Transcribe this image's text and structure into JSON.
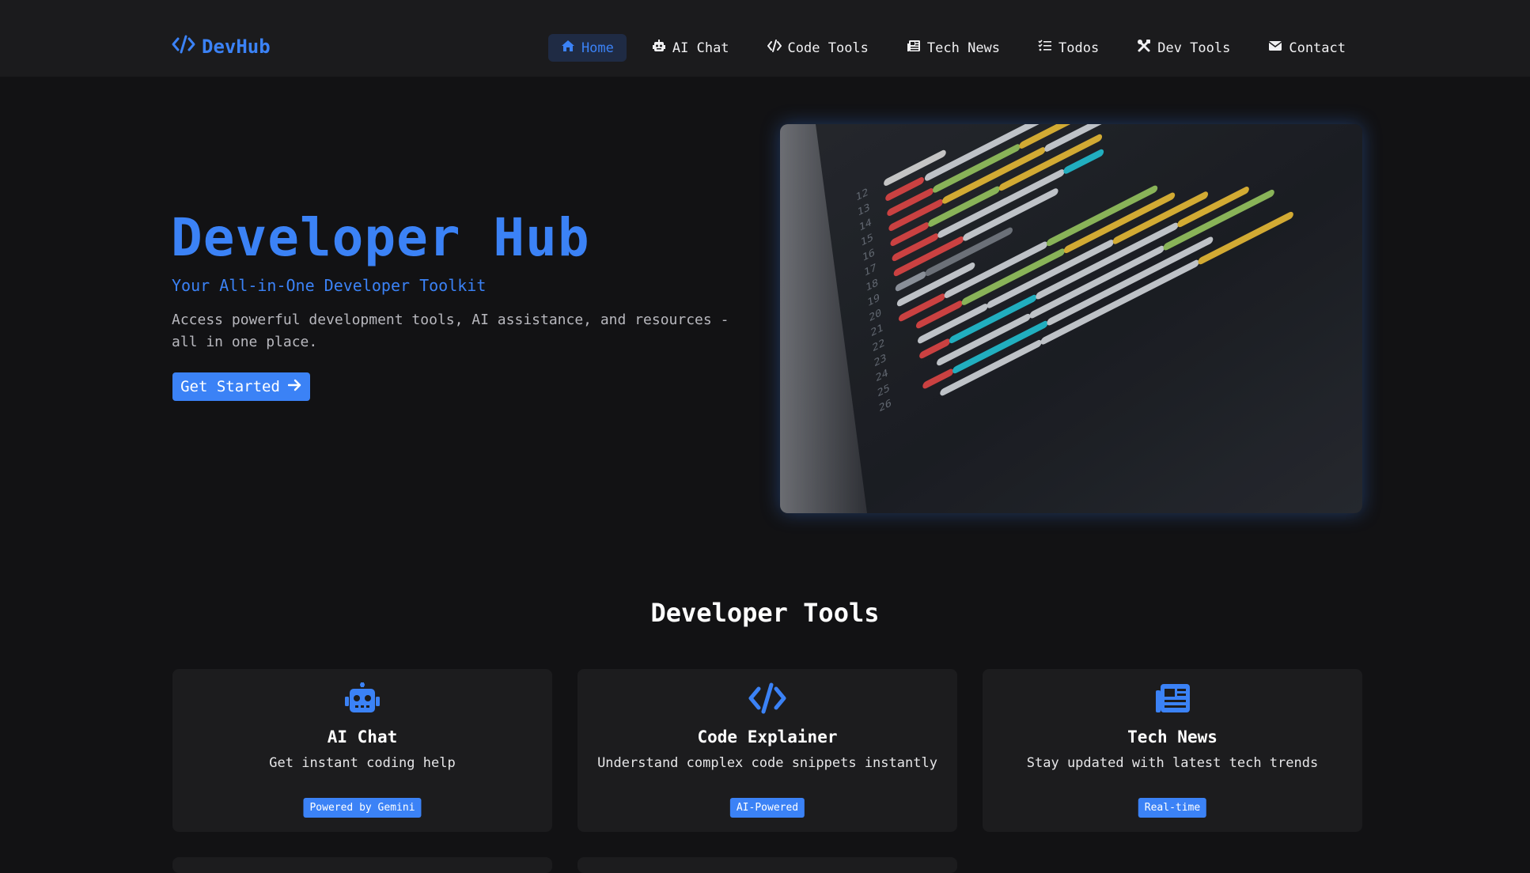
{
  "brand": {
    "name": "DevHub",
    "icon": "code-icon"
  },
  "nav": {
    "items": [
      {
        "label": "Home",
        "icon": "home-icon",
        "active": true
      },
      {
        "label": "AI Chat",
        "icon": "robot-icon",
        "active": false
      },
      {
        "label": "Code Tools",
        "icon": "code-icon",
        "active": false
      },
      {
        "label": "Tech News",
        "icon": "newspaper-icon",
        "active": false
      },
      {
        "label": "Todos",
        "icon": "tasks-icon",
        "active": false
      },
      {
        "label": "Dev Tools",
        "icon": "tools-icon",
        "active": false
      },
      {
        "label": "Contact",
        "icon": "envelope-icon",
        "active": false
      }
    ]
  },
  "hero": {
    "title": "Developer Hub",
    "subtitle": "Your All-in-One Developer Toolkit",
    "description": "Access powerful development tools, AI assistance, and resources - all in one place.",
    "cta_label": "Get Started",
    "cta_icon": "arrow-right-icon"
  },
  "tools": {
    "title": "Developer Tools",
    "cards": [
      {
        "icon": "robot-icon",
        "title": "AI Chat",
        "description": "Get instant coding help",
        "badge": "Powered by Gemini"
      },
      {
        "icon": "code-icon",
        "title": "Code Explainer",
        "description": "Understand complex code snippets instantly",
        "badge": "AI-Powered"
      },
      {
        "icon": "newspaper-icon",
        "title": "Tech News",
        "description": "Stay updated with latest tech trends",
        "badge": "Real-time"
      }
    ]
  },
  "colors": {
    "accent": "#3b82f6",
    "background": "#121214",
    "navbar": "#1b1b1d",
    "card": "#1c1c1e"
  }
}
